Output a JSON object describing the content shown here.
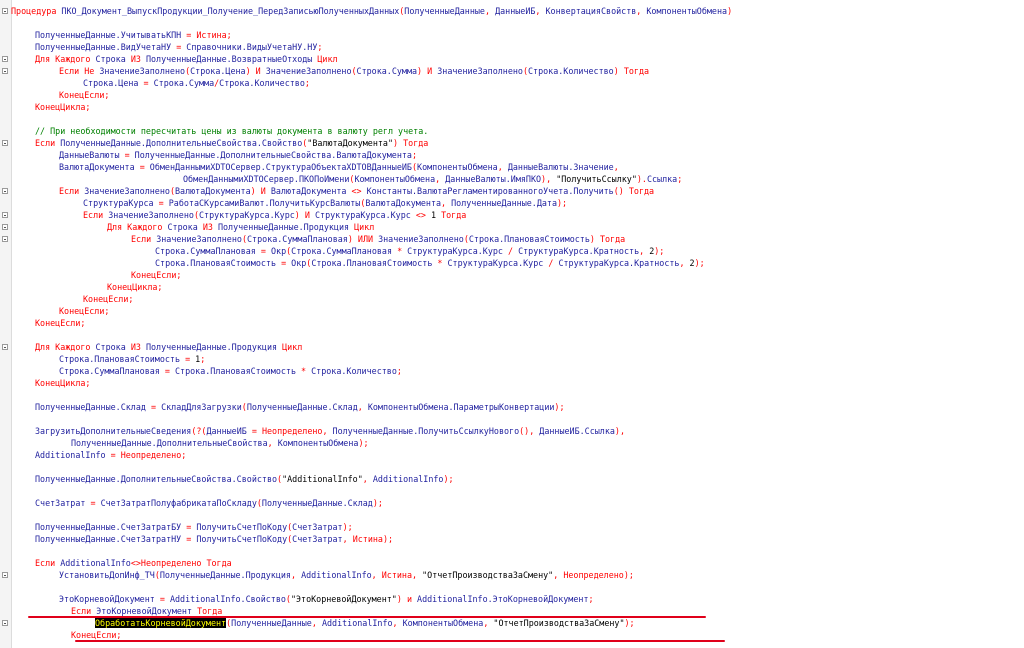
{
  "editor": {
    "language": "1C",
    "lines": [
      [
        [
          "k",
          "Процедура "
        ],
        [
          "i",
          "ПКО_Документ_ВыпускПродукции_Получение_ПередЗаписьюПолученныхДанных"
        ],
        [
          "p",
          "("
        ],
        [
          "i",
          "ПолученныеДанные"
        ],
        [
          "p",
          ", "
        ],
        [
          "i",
          "ДанныеИБ"
        ],
        [
          "p",
          ", "
        ],
        [
          "i",
          "КонвертацияСвойств"
        ],
        [
          "p",
          ", "
        ],
        [
          "i",
          "КомпонентыОбмена"
        ],
        [
          "p",
          ")"
        ]
      ],
      [],
      [
        [
          "i",
          "ПолученныеДанные.УчитыватьКПН "
        ],
        [
          "p",
          "= "
        ],
        [
          "k",
          "Истина"
        ],
        [
          "p",
          ";"
        ]
      ],
      [
        [
          "i",
          "ПолученныеДанные.ВидУчетаНУ "
        ],
        [
          "p",
          "= "
        ],
        [
          "i",
          "Справочники.ВидыУчетаНУ.НУ"
        ],
        [
          "p",
          ";"
        ]
      ],
      [
        [
          "k",
          "Для Каждого "
        ],
        [
          "i",
          "Строка "
        ],
        [
          "k",
          "ИЗ "
        ],
        [
          "i",
          "ПолученныеДанные.ВозвратныеОтходы "
        ],
        [
          "k",
          "Цикл"
        ]
      ],
      [
        [
          "k",
          "Если Не "
        ],
        [
          "i",
          "ЗначениеЗаполнено"
        ],
        [
          "p",
          "("
        ],
        [
          "i",
          "Строка.Цена"
        ],
        [
          "p",
          ") "
        ],
        [
          "k",
          "И "
        ],
        [
          "i",
          "ЗначениеЗаполнено"
        ],
        [
          "p",
          "("
        ],
        [
          "i",
          "Строка.Сумма"
        ],
        [
          "p",
          ") "
        ],
        [
          "k",
          "И "
        ],
        [
          "i",
          "ЗначениеЗаполнено"
        ],
        [
          "p",
          "("
        ],
        [
          "i",
          "Строка.Количество"
        ],
        [
          "p",
          ") "
        ],
        [
          "k",
          "Тогда"
        ]
      ],
      [
        [
          "i",
          "Строка.Цена "
        ],
        [
          "p",
          "= "
        ],
        [
          "i",
          "Строка.Сумма"
        ],
        [
          "p",
          "/"
        ],
        [
          "i",
          "Строка.Количество"
        ],
        [
          "p",
          ";"
        ]
      ],
      [
        [
          "k",
          "КонецЕсли"
        ],
        [
          "p",
          ";"
        ]
      ],
      [
        [
          "k",
          "КонецЦикла"
        ],
        [
          "p",
          ";"
        ]
      ],
      [],
      [
        [
          "c",
          "// При необходимости пересчитать цены из валюты документа в валюту регл учета."
        ]
      ],
      [
        [
          "k",
          "Если "
        ],
        [
          "i",
          "ПолученныеДанные.ДополнительныеСвойства.Свойство"
        ],
        [
          "p",
          "("
        ],
        [
          "s",
          "\"ВалютаДокумента\""
        ],
        [
          "p",
          ") "
        ],
        [
          "k",
          "Тогда"
        ]
      ],
      [
        [
          "i",
          "ДанныеВалюты "
        ],
        [
          "p",
          "= "
        ],
        [
          "i",
          "ПолученныеДанные.ДополнительныеСвойства.ВалютаДокумента"
        ],
        [
          "p",
          ";"
        ]
      ],
      [
        [
          "i",
          "ВалютаДокумента "
        ],
        [
          "p",
          "= "
        ],
        [
          "i",
          "ОбменДаннымиXDTOСервер.СтруктураОбъектаXDTOВДанныеИБ"
        ],
        [
          "p",
          "("
        ],
        [
          "i",
          "КомпонентыОбмена"
        ],
        [
          "p",
          ", "
        ],
        [
          "i",
          "ДанныеВалюты.Значение"
        ],
        [
          "p",
          ","
        ]
      ],
      [
        [
          "i",
          "ОбменДаннымиXDTOСервер.ПКОПоИмени"
        ],
        [
          "p",
          "("
        ],
        [
          "i",
          "КомпонентыОбмена"
        ],
        [
          "p",
          ", "
        ],
        [
          "i",
          "ДанныеВалюты.ИмяПКО"
        ],
        [
          "p",
          "), "
        ],
        [
          "s",
          "\"ПолучитьСсылку\""
        ],
        [
          "p",
          ")."
        ],
        [
          "i",
          "Ссылка"
        ],
        [
          "p",
          ";"
        ]
      ],
      [
        [
          "k",
          "Если "
        ],
        [
          "i",
          "ЗначениеЗаполнено"
        ],
        [
          "p",
          "("
        ],
        [
          "i",
          "ВалютаДокумента"
        ],
        [
          "p",
          ") "
        ],
        [
          "k",
          "И "
        ],
        [
          "i",
          "ВалютаДокумента "
        ],
        [
          "p",
          "<> "
        ],
        [
          "i",
          "Константы.ВалютаРегламентированногоУчета.Получить"
        ],
        [
          "p",
          "() "
        ],
        [
          "k",
          "Тогда"
        ]
      ],
      [
        [
          "i",
          "СтруктураКурса "
        ],
        [
          "p",
          "= "
        ],
        [
          "i",
          "РаботаСКурсамиВалют.ПолучитьКурсВалюты"
        ],
        [
          "p",
          "("
        ],
        [
          "i",
          "ВалютаДокумента"
        ],
        [
          "p",
          ", "
        ],
        [
          "i",
          "ПолученныеДанные.Дата"
        ],
        [
          "p",
          ");"
        ]
      ],
      [
        [
          "k",
          "Если "
        ],
        [
          "i",
          "ЗначениеЗаполнено"
        ],
        [
          "p",
          "("
        ],
        [
          "i",
          "СтруктураКурса.Курс"
        ],
        [
          "p",
          ") "
        ],
        [
          "k",
          "И "
        ],
        [
          "i",
          "СтруктураКурса.Курс "
        ],
        [
          "p",
          "<> "
        ],
        [
          "n",
          "1 "
        ],
        [
          "k",
          "Тогда"
        ]
      ],
      [
        [
          "k",
          "Для Каждого "
        ],
        [
          "i",
          "Строка "
        ],
        [
          "k",
          "ИЗ "
        ],
        [
          "i",
          "ПолученныеДанные.Продукция "
        ],
        [
          "k",
          "Цикл"
        ]
      ],
      [
        [
          "k",
          "Если "
        ],
        [
          "i",
          "ЗначениеЗаполнено"
        ],
        [
          "p",
          "("
        ],
        [
          "i",
          "Строка.СуммаПлановая"
        ],
        [
          "p",
          ") "
        ],
        [
          "k",
          "ИЛИ "
        ],
        [
          "i",
          "ЗначениеЗаполнено"
        ],
        [
          "p",
          "("
        ],
        [
          "i",
          "Строка.ПлановаяСтоимость"
        ],
        [
          "p",
          ") "
        ],
        [
          "k",
          "Тогда"
        ]
      ],
      [
        [
          "i",
          "Строка.СуммаПлановая "
        ],
        [
          "p",
          "= "
        ],
        [
          "i",
          "Окр"
        ],
        [
          "p",
          "("
        ],
        [
          "i",
          "Строка.СуммаПлановая "
        ],
        [
          "p",
          "* "
        ],
        [
          "i",
          "СтруктураКурса.Курс "
        ],
        [
          "p",
          "/ "
        ],
        [
          "i",
          "СтруктураКурса.Кратность"
        ],
        [
          "p",
          ", "
        ],
        [
          "n",
          "2"
        ],
        [
          "p",
          ");"
        ]
      ],
      [
        [
          "i",
          "Строка.ПлановаяСтоимость "
        ],
        [
          "p",
          "= "
        ],
        [
          "i",
          "Окр"
        ],
        [
          "p",
          "("
        ],
        [
          "i",
          "Строка.ПлановаяСтоимость "
        ],
        [
          "p",
          "* "
        ],
        [
          "i",
          "СтруктураКурса.Курс "
        ],
        [
          "p",
          "/ "
        ],
        [
          "i",
          "СтруктураКурса.Кратность"
        ],
        [
          "p",
          ", "
        ],
        [
          "n",
          "2"
        ],
        [
          "p",
          ");"
        ]
      ],
      [
        [
          "k",
          "КонецЕсли"
        ],
        [
          "p",
          ";"
        ]
      ],
      [
        [
          "k",
          "КонецЦикла"
        ],
        [
          "p",
          ";"
        ]
      ],
      [
        [
          "k",
          "КонецЕсли"
        ],
        [
          "p",
          ";"
        ]
      ],
      [
        [
          "k",
          "КонецЕсли"
        ],
        [
          "p",
          ";"
        ]
      ],
      [
        [
          "k",
          "КонецЕсли"
        ],
        [
          "p",
          ";"
        ]
      ],
      [],
      [
        [
          "k",
          "Для Каждого "
        ],
        [
          "i",
          "Строка "
        ],
        [
          "k",
          "ИЗ "
        ],
        [
          "i",
          "ПолученныеДанные.Продукция "
        ],
        [
          "k",
          "Цикл"
        ]
      ],
      [
        [
          "i",
          "Строка.ПлановаяСтоимость "
        ],
        [
          "p",
          "= "
        ],
        [
          "n",
          "1"
        ],
        [
          "p",
          ";"
        ]
      ],
      [
        [
          "i",
          "Строка.СуммаПлановая "
        ],
        [
          "p",
          "= "
        ],
        [
          "i",
          "Строка.ПлановаяСтоимость "
        ],
        [
          "p",
          "* "
        ],
        [
          "i",
          "Строка.Количество"
        ],
        [
          "p",
          ";"
        ]
      ],
      [
        [
          "k",
          "КонецЦикла"
        ],
        [
          "p",
          ";"
        ]
      ],
      [],
      [
        [
          "i",
          "ПолученныеДанные.Склад "
        ],
        [
          "p",
          "= "
        ],
        [
          "i",
          "СкладДляЗагрузки"
        ],
        [
          "p",
          "("
        ],
        [
          "i",
          "ПолученныеДанные.Склад"
        ],
        [
          "p",
          ", "
        ],
        [
          "i",
          "КомпонентыОбмена.ПараметрыКонвертации"
        ],
        [
          "p",
          ");"
        ]
      ],
      [],
      [
        [
          "i",
          "ЗагрузитьДополнительныеСведения"
        ],
        [
          "p",
          "(?("
        ],
        [
          "i",
          "ДанныеИБ "
        ],
        [
          "p",
          "= "
        ],
        [
          "k",
          "Неопределено"
        ],
        [
          "p",
          ", "
        ],
        [
          "i",
          "ПолученныеДанные.ПолучитьСсылкуНового"
        ],
        [
          "p",
          "(), "
        ],
        [
          "i",
          "ДанныеИБ.Ссылка"
        ],
        [
          "p",
          "),"
        ]
      ],
      [
        [
          "i",
          "ПолученныеДанные.ДополнительныеСвойства"
        ],
        [
          "p",
          ", "
        ],
        [
          "i",
          "КомпонентыОбмена"
        ],
        [
          "p",
          ");"
        ]
      ],
      [
        [
          "i",
          "AdditionalInfo "
        ],
        [
          "p",
          "= "
        ],
        [
          "k",
          "Неопределено"
        ],
        [
          "p",
          ";"
        ]
      ],
      [],
      [
        [
          "i",
          "ПолученныеДанные.ДополнительныеСвойства.Свойство"
        ],
        [
          "p",
          "("
        ],
        [
          "s",
          "\"AdditionalInfo\""
        ],
        [
          "p",
          ", "
        ],
        [
          "i",
          "AdditionalInfo"
        ],
        [
          "p",
          ");"
        ]
      ],
      [],
      [
        [
          "i",
          "СчетЗатрат "
        ],
        [
          "p",
          "= "
        ],
        [
          "i",
          "СчетЗатратПолуфабрикатаПоСкладу"
        ],
        [
          "p",
          "("
        ],
        [
          "i",
          "ПолученныеДанные.Склад"
        ],
        [
          "p",
          ");"
        ]
      ],
      [],
      [
        [
          "i",
          "ПолученныеДанные.СчетЗатратБУ "
        ],
        [
          "p",
          "= "
        ],
        [
          "i",
          "ПолучитьСчетПоКоду"
        ],
        [
          "p",
          "("
        ],
        [
          "i",
          "СчетЗатрат"
        ],
        [
          "p",
          ");"
        ]
      ],
      [
        [
          "i",
          "ПолученныеДанные.СчетЗатратНУ "
        ],
        [
          "p",
          "= "
        ],
        [
          "i",
          "ПолучитьСчетПоКоду"
        ],
        [
          "p",
          "("
        ],
        [
          "i",
          "СчетЗатрат"
        ],
        [
          "p",
          ", "
        ],
        [
          "k",
          "Истина"
        ],
        [
          "p",
          ");"
        ]
      ],
      [],
      [
        [
          "k",
          "Если "
        ],
        [
          "i",
          "AdditionalInfo"
        ],
        [
          "p",
          "<>"
        ],
        [
          "k",
          "Неопределено Тогда"
        ]
      ],
      [
        [
          "i",
          "УстановитьДопИнф_ТЧ"
        ],
        [
          "p",
          "("
        ],
        [
          "i",
          "ПолученныеДанные.Продукция"
        ],
        [
          "p",
          ", "
        ],
        [
          "i",
          "AdditionalInfo"
        ],
        [
          "p",
          ", "
        ],
        [
          "k",
          "Истина"
        ],
        [
          "p",
          ", "
        ],
        [
          "s",
          "\"ОтчетПроизводстваЗаСмену\""
        ],
        [
          "p",
          ", "
        ],
        [
          "k",
          "Неопределено"
        ],
        [
          "p",
          ");"
        ]
      ],
      [],
      [
        [
          "i",
          "ЭтоКорневойДокумент "
        ],
        [
          "p",
          "= "
        ],
        [
          "i",
          "AdditionalInfo.Свойство"
        ],
        [
          "p",
          "("
        ],
        [
          "s",
          "\"ЭтоКорневойДокумент\""
        ],
        [
          "p",
          ") "
        ],
        [
          "k",
          "и "
        ],
        [
          "i",
          "AdditionalInfo.ЭтоКорневойДокумент"
        ],
        [
          "p",
          ";"
        ]
      ],
      [
        [
          "k",
          "Если "
        ],
        [
          "i",
          "ЭтоКорневойДокумент "
        ],
        [
          "k",
          "Тогда"
        ]
      ],
      [
        [
          "hl",
          "ОбработатьКорневойДокумент"
        ],
        [
          "p",
          "("
        ],
        [
          "i",
          "ПолученныеДанные"
        ],
        [
          "p",
          ", "
        ],
        [
          "i",
          "AdditionalInfo"
        ],
        [
          "p",
          ", "
        ],
        [
          "i",
          "КомпонентыОбмена"
        ],
        [
          "p",
          ", "
        ],
        [
          "s",
          "\"ОтчетПроизводстваЗаСмену\""
        ],
        [
          "p",
          ");"
        ]
      ],
      [
        [
          "k",
          "КонецЕсли"
        ],
        [
          "p",
          ";"
        ]
      ]
    ]
  },
  "colors": {
    "keyword": "#ff0000",
    "identifier": "#1f1f9e",
    "string": "#000000",
    "comment": "#008000",
    "highlight_bg": "#000000",
    "highlight_fg": "#ffff00",
    "annotation": "#e0001a"
  },
  "annotations": {
    "underlined_lines": [
      50,
      52
    ]
  }
}
